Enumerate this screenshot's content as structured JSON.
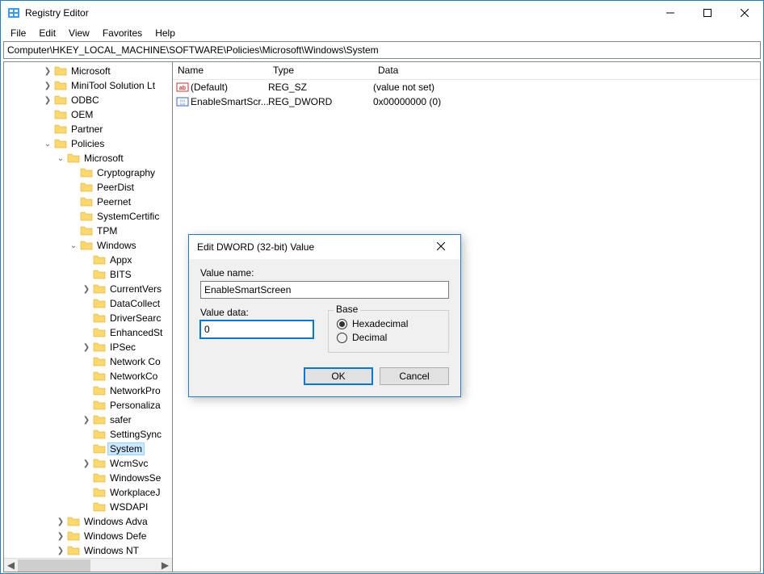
{
  "window": {
    "title": "Registry Editor"
  },
  "menu": {
    "file": "File",
    "edit": "Edit",
    "view": "View",
    "favorites": "Favorites",
    "help": "Help"
  },
  "address": "Computer\\HKEY_LOCAL_MACHINE\\SOFTWARE\\Policies\\Microsoft\\Windows\\System",
  "columns": {
    "name": "Name",
    "type": "Type",
    "data": "Data"
  },
  "values": [
    {
      "icon": "ab",
      "name": "(Default)",
      "type": "REG_SZ",
      "data": "(value not set)"
    },
    {
      "icon": "bin",
      "name": "EnableSmartScr...",
      "type": "REG_DWORD",
      "data": "0x00000000 (0)"
    }
  ],
  "tree": [
    {
      "indent": 3,
      "exp": ">",
      "label": "Microsoft"
    },
    {
      "indent": 3,
      "exp": ">",
      "label": "MiniTool Solution Lt"
    },
    {
      "indent": 3,
      "exp": ">",
      "label": "ODBC"
    },
    {
      "indent": 3,
      "exp": "",
      "label": "OEM"
    },
    {
      "indent": 3,
      "exp": "",
      "label": "Partner"
    },
    {
      "indent": 3,
      "exp": "v",
      "label": "Policies"
    },
    {
      "indent": 4,
      "exp": "v",
      "label": "Microsoft"
    },
    {
      "indent": 5,
      "exp": "",
      "label": "Cryptography"
    },
    {
      "indent": 5,
      "exp": "",
      "label": "PeerDist"
    },
    {
      "indent": 5,
      "exp": "",
      "label": "Peernet"
    },
    {
      "indent": 5,
      "exp": "",
      "label": "SystemCertific"
    },
    {
      "indent": 5,
      "exp": "",
      "label": "TPM"
    },
    {
      "indent": 5,
      "exp": "v",
      "label": "Windows"
    },
    {
      "indent": 6,
      "exp": "",
      "label": "Appx"
    },
    {
      "indent": 6,
      "exp": "",
      "label": "BITS"
    },
    {
      "indent": 6,
      "exp": ">",
      "label": "CurrentVers"
    },
    {
      "indent": 6,
      "exp": "",
      "label": "DataCollect"
    },
    {
      "indent": 6,
      "exp": "",
      "label": "DriverSearc"
    },
    {
      "indent": 6,
      "exp": "",
      "label": "EnhancedSt"
    },
    {
      "indent": 6,
      "exp": ">",
      "label": "IPSec"
    },
    {
      "indent": 6,
      "exp": "",
      "label": "Network Co"
    },
    {
      "indent": 6,
      "exp": "",
      "label": "NetworkCo"
    },
    {
      "indent": 6,
      "exp": "",
      "label": "NetworkPro"
    },
    {
      "indent": 6,
      "exp": "",
      "label": "Personaliza"
    },
    {
      "indent": 6,
      "exp": ">",
      "label": "safer"
    },
    {
      "indent": 6,
      "exp": "",
      "label": "SettingSync"
    },
    {
      "indent": 6,
      "exp": "",
      "label": "System",
      "selected": true
    },
    {
      "indent": 6,
      "exp": ">",
      "label": "WcmSvc"
    },
    {
      "indent": 6,
      "exp": "",
      "label": "WindowsSe"
    },
    {
      "indent": 6,
      "exp": "",
      "label": "WorkplaceJ"
    },
    {
      "indent": 6,
      "exp": "",
      "label": "WSDAPI"
    },
    {
      "indent": 4,
      "exp": ">",
      "label": "Windows Adva"
    },
    {
      "indent": 4,
      "exp": ">",
      "label": "Windows Defe"
    },
    {
      "indent": 4,
      "exp": ">",
      "label": "Windows NT"
    }
  ],
  "dialog": {
    "title": "Edit DWORD (32-bit) Value",
    "name_label": "Value name:",
    "name_value": "EnableSmartScreen",
    "data_label": "Value data:",
    "data_value": "0",
    "base_label": "Base",
    "hex": "Hexadecimal",
    "dec": "Decimal",
    "ok": "OK",
    "cancel": "Cancel"
  }
}
